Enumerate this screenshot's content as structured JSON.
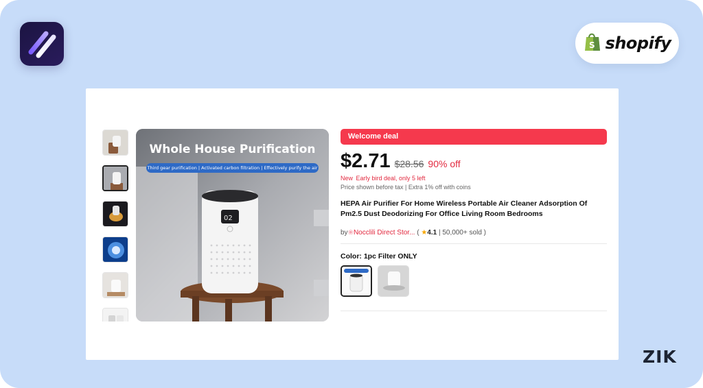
{
  "brand": {
    "app_logo_icon": "lightning-stripes-logo-icon",
    "shopify_text": "shopify",
    "shopify_bag_icon": "shopify-bag-icon",
    "zik_text": "ZIK"
  },
  "product": {
    "main_image": {
      "title": "Whole House Purification",
      "subtitle": "Third gear purification | Activated carbon filtration | Effectively purify the air"
    },
    "deal_label": "Welcome deal",
    "price": "$2.71",
    "old_price": "$28.56",
    "discount": "90% off",
    "early_bird": "New Early bird deal, only 5 left",
    "tax_note": "Price shown before tax | Extra 1% off with coins",
    "title": "HEPA Air Purifier For Home Wireless Portable Air Cleaner Adsorption Of Pm2.5 Dust Deodorizing For Office Living Room Bedrooms",
    "seller_prefix": "by",
    "seller_name": "Nocclili Direct Stor...",
    "rating": "4.1",
    "sold": "50,000+ sold",
    "color_label": "Color: 1pc Filter ONLY"
  },
  "colors": {
    "deal_red": "#f5394d",
    "accent_red": "#e2293f",
    "background": "#c7dcf9",
    "shopify_green": "#95bf47"
  }
}
